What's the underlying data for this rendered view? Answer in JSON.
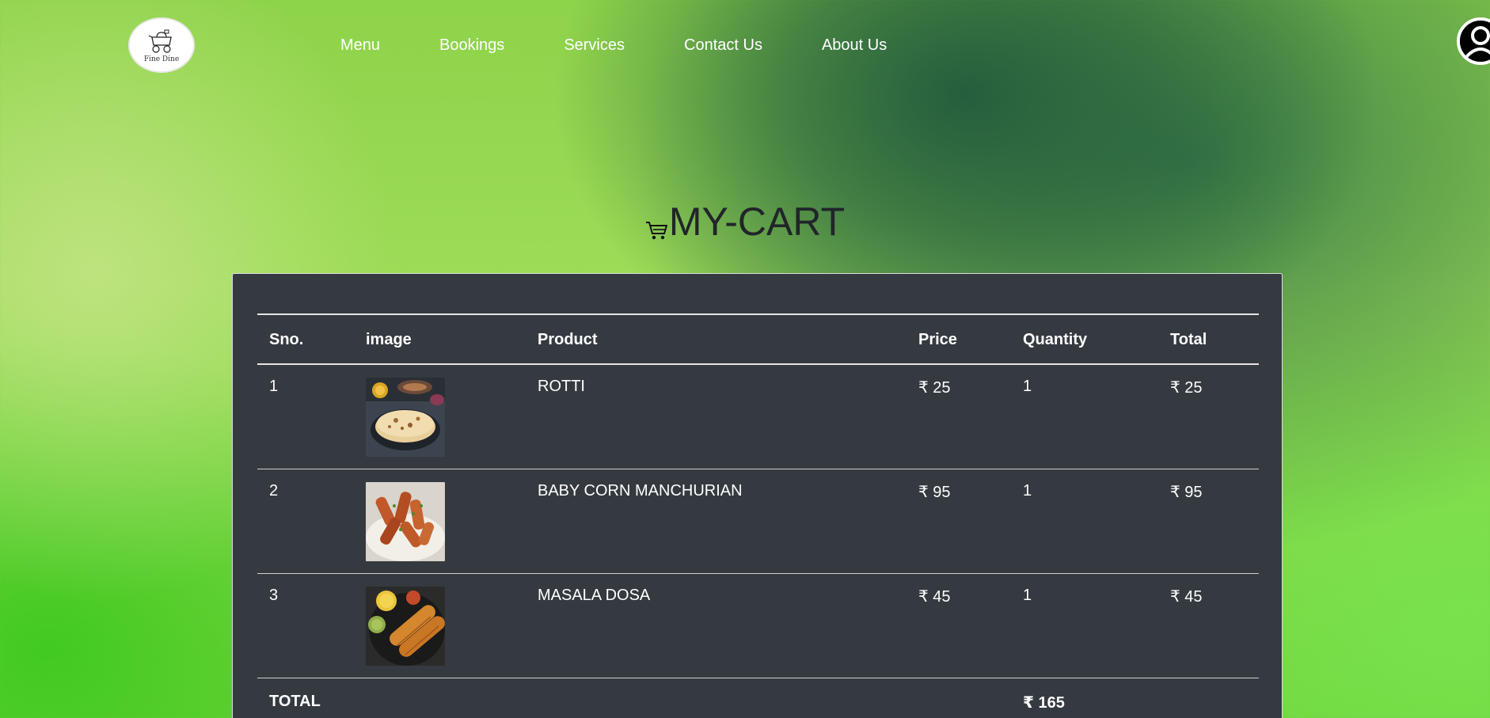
{
  "brand": {
    "logo_text": "Fine Dine",
    "logo_icon": "food-cart-icon"
  },
  "nav": {
    "items": [
      {
        "label": "Menu"
      },
      {
        "label": "Bookings"
      },
      {
        "label": "Services"
      },
      {
        "label": "Contact Us"
      },
      {
        "label": "About Us"
      }
    ],
    "profile_icon": "user-profile-icon"
  },
  "page": {
    "title": "MY-CART",
    "title_icon": "cart-icon"
  },
  "cart": {
    "headers": {
      "sno": "Sno.",
      "image": "image",
      "product": "Product",
      "price": "Price",
      "quantity": "Quantity",
      "total": "Total"
    },
    "items": [
      {
        "sno": "1",
        "image": "rotti-photo",
        "product": "ROTTI",
        "price": "₹ 25",
        "quantity": "1",
        "total": "₹ 25"
      },
      {
        "sno": "2",
        "image": "baby-corn-manchurian-photo",
        "product": "BABY CORN MANCHURIAN",
        "price": "₹ 95",
        "quantity": "1",
        "total": "₹ 95"
      },
      {
        "sno": "3",
        "image": "masala-dosa-photo",
        "product": "MASALA DOSA",
        "price": "₹ 45",
        "quantity": "1",
        "total": "₹ 45"
      }
    ],
    "total_label": "TOTAL",
    "total_value": "₹ 165"
  },
  "colors": {
    "card_bg": "#343a40",
    "text_light": "#ffffff",
    "title_text": "#212529"
  }
}
